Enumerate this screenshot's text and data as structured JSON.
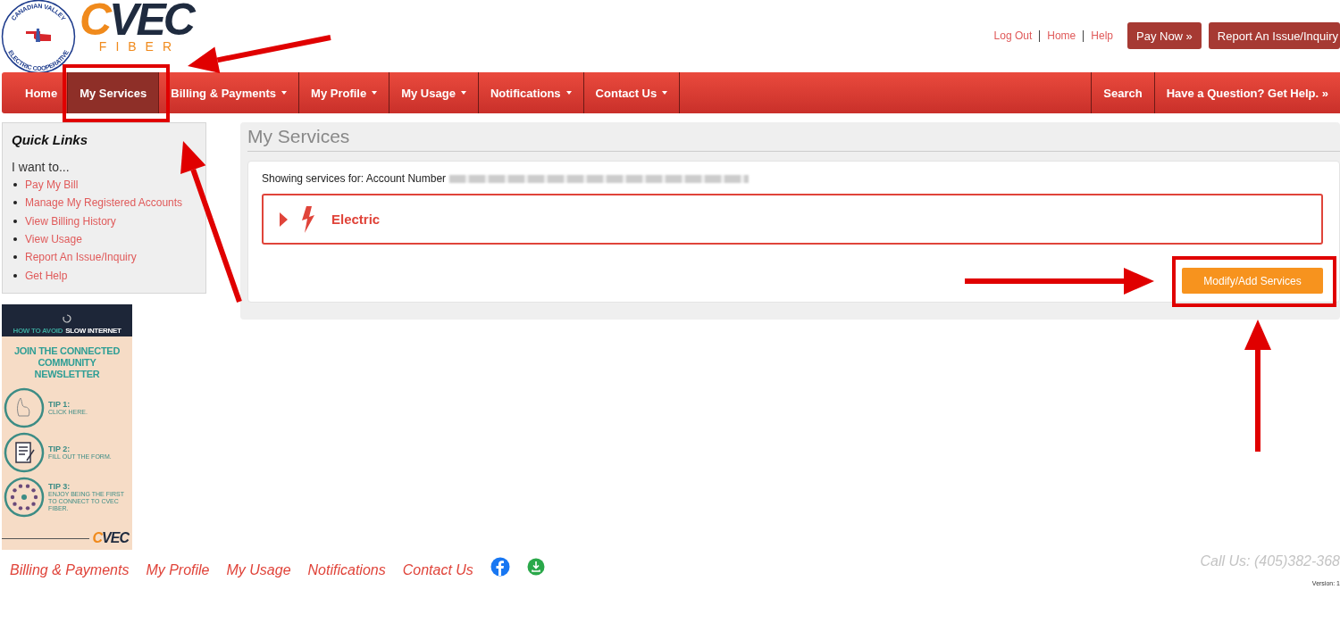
{
  "header": {
    "seal_top": "CANADIAN VALLEY",
    "seal_bottom": "ELECTRIC COOPERATIVE",
    "brand": "CVEC",
    "brand_sub": "FIBER",
    "top_links": [
      "Log Out",
      "Home",
      "Help"
    ],
    "buttons": [
      "Pay Now »",
      "Report An Issue/Inquiry"
    ]
  },
  "nav": {
    "items": [
      {
        "label": "Home",
        "selected": false,
        "dropdown": false
      },
      {
        "label": "My Services",
        "selected": true,
        "dropdown": false
      },
      {
        "label": "Billing & Payments",
        "selected": false,
        "dropdown": true
      },
      {
        "label": "My Profile",
        "selected": false,
        "dropdown": true
      },
      {
        "label": "My Usage",
        "selected": false,
        "dropdown": true
      },
      {
        "label": "Notifications",
        "selected": false,
        "dropdown": true
      },
      {
        "label": "Contact Us",
        "selected": false,
        "dropdown": true
      }
    ],
    "right_items": [
      "Search",
      "Have a Question? Get Help. »"
    ]
  },
  "quick_links": {
    "title": "Quick Links",
    "intro": "I want to...",
    "links": [
      "Pay My Bill",
      "Manage My Registered Accounts",
      "View Billing History",
      "View Usage",
      "Report An Issue/Inquiry",
      "Get Help"
    ]
  },
  "banner": {
    "heading_a": "HOW TO AVOID",
    "heading_b": "SLOW INTERNET",
    "title": "JOIN THE CONNECTED COMMUNITY NEWSLETTER",
    "tips": [
      {
        "kind": "hand",
        "title": "TIP 1:",
        "text": "CLICK HERE."
      },
      {
        "kind": "form",
        "title": "TIP 2:",
        "text": "FILL OUT THE FORM."
      },
      {
        "kind": "people",
        "title": "TIP 3:",
        "text": "ENJOY BEING THE FIRST TO CONNECT TO CVEC FIBER."
      }
    ],
    "brand": "CVEC"
  },
  "services": {
    "title": "My Services",
    "account_label": "Showing services for: Account Number",
    "items": [
      {
        "kind": "electric",
        "name": "Electric",
        "expanded": false
      }
    ],
    "button": "Modify/Add Services"
  },
  "footer": {
    "links": [
      "Billing & Payments",
      "My Profile",
      "My Usage",
      "Notifications",
      "Contact Us"
    ],
    "social": [
      {
        "kind": "facebook"
      },
      {
        "kind": "download"
      }
    ],
    "phone": "Call Us: (405)382-368",
    "version": "Version: 1"
  },
  "annotations": [
    {
      "kind": "box"
    },
    {
      "kind": "arrow"
    },
    {
      "kind": "arrow"
    },
    {
      "kind": "box"
    },
    {
      "kind": "arrow"
    },
    {
      "kind": "arrow"
    }
  ]
}
